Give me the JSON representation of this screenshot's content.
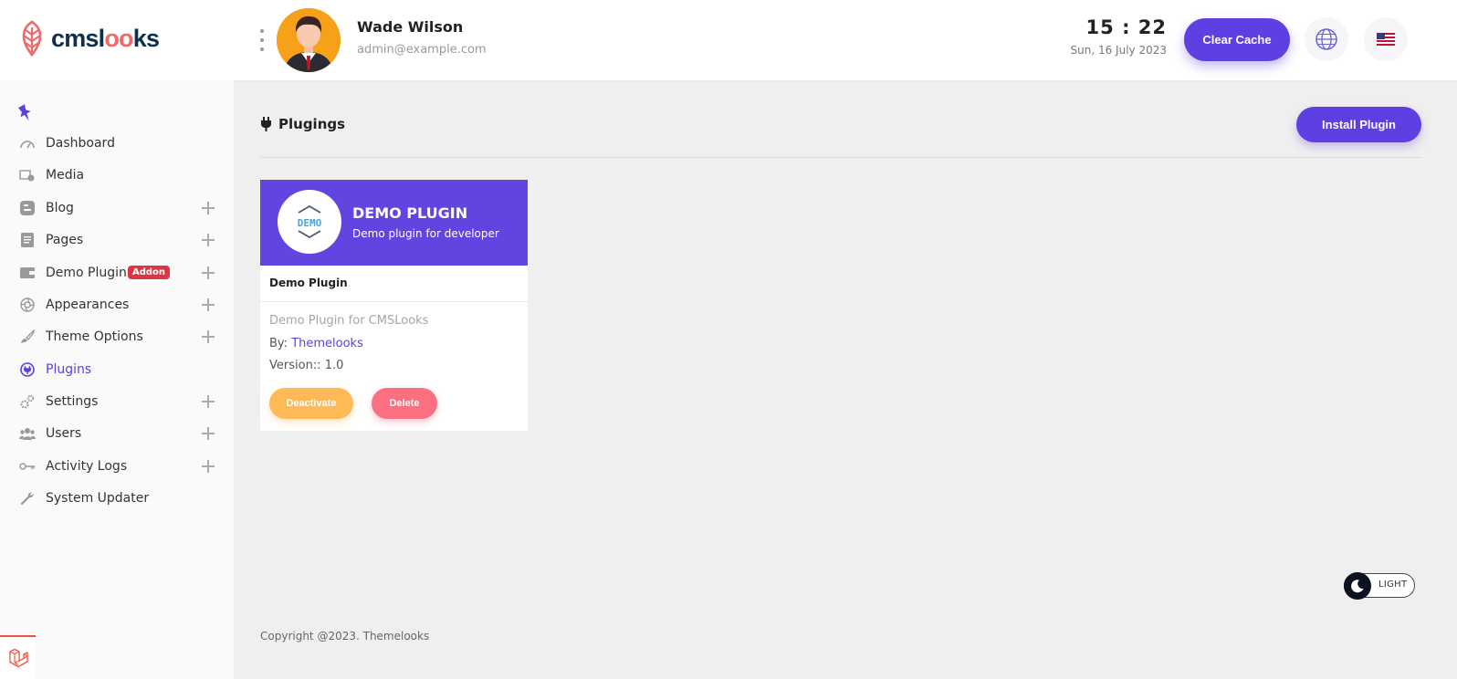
{
  "brand": {
    "name_prefix": "cmsl",
    "name_highlight": "oo",
    "name_suffix": "ks",
    "accent": "#5d3fe2",
    "logo_color": "#f06a6a"
  },
  "header": {
    "user_name": "Wade Wilson",
    "user_email": "admin@example.com",
    "time": "15 : 22",
    "date": "Sun, 16 July 2023",
    "clear_cache_label": "Clear Cache",
    "icons": [
      "globe-icon",
      "us-flag-icon"
    ]
  },
  "sidebar": {
    "items": [
      {
        "label": "Dashboard",
        "icon": "gauge-icon",
        "expandable": false
      },
      {
        "label": "Media",
        "icon": "media-icon",
        "expandable": false
      },
      {
        "label": "Blog",
        "icon": "blogger-icon",
        "expandable": true
      },
      {
        "label": "Pages",
        "icon": "page-icon",
        "expandable": true
      },
      {
        "label": "Demo Plugin",
        "icon": "wallet-icon",
        "expandable": true,
        "badge": "Addon"
      },
      {
        "label": "Appearances",
        "icon": "aperture-icon",
        "expandable": true
      },
      {
        "label": "Theme Options",
        "icon": "brush-icon",
        "expandable": true
      },
      {
        "label": "Plugins",
        "icon": "plugin-icon",
        "expandable": false,
        "active": true
      },
      {
        "label": "Settings",
        "icon": "cogs-icon",
        "expandable": true
      },
      {
        "label": "Users",
        "icon": "users-icon",
        "expandable": true
      },
      {
        "label": "Activity Logs",
        "icon": "key-icon",
        "expandable": true
      },
      {
        "label": "System Updater",
        "icon": "wrench-icon",
        "expandable": false
      }
    ]
  },
  "main": {
    "title": "Plugings",
    "install_label": "Install Plugin",
    "plugin": {
      "logo_text": "DEMO",
      "banner_title": "DEMO PLUGIN",
      "banner_subtitle": "Demo plugin for developer",
      "name": "Demo Plugin",
      "description": "Demo Plugin for CMSLooks",
      "by_label": "By:",
      "author": "Themelooks",
      "version_label": "Version::",
      "version": "1.0",
      "deactivate_label": "Deactivate",
      "delete_label": "Delete"
    }
  },
  "theme_toggle": {
    "label": "LIGHT"
  },
  "footer": {
    "copyright": "Copyright @2023. Themelooks"
  }
}
